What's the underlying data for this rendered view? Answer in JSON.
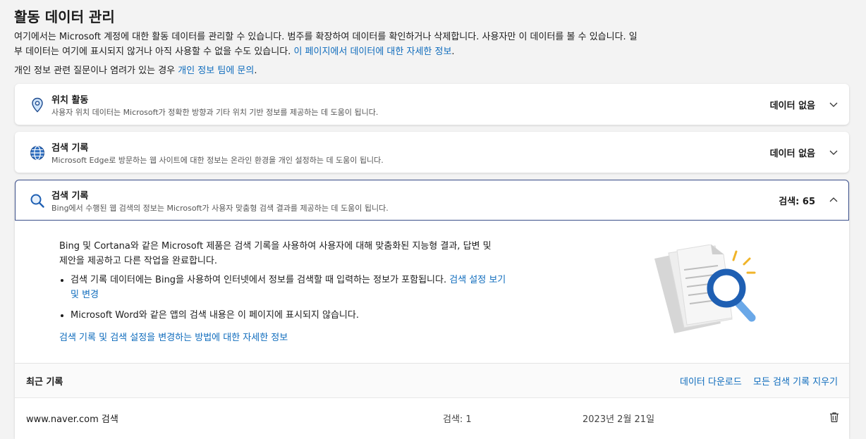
{
  "page": {
    "title": "활동 데이터 관리",
    "intro_text": "여기에서는 Microsoft 계정에 대한 활동 데이터를 관리할 수 있습니다. 범주를 확장하여 데이터를 확인하거나 삭제합니다. 사용자만 이 데이터를 볼 수 있습니다. 일부 데이터는 여기에 표시되지 않거나 아직 사용할 수 없을 수도 있습니다. ",
    "intro_link": "이 페이지에서 데이터에 대한 자세한 정보",
    "intro_end": ".",
    "privacy_text": "개인 정보 관련 질문이나 염려가 있는 경우 ",
    "privacy_link": "개인 정보 팀에 문의",
    "privacy_end": "."
  },
  "cards": [
    {
      "title": "위치 활동",
      "desc": "사용자 위치 데이터는 Microsoft가 정확한 방향과 기타 위치 기반 정보를 제공하는 데 도움이 됩니다.",
      "status": "데이터 없음",
      "icon": "location-pin-icon"
    },
    {
      "title": "검색 기록",
      "desc": "Microsoft Edge로 방문하는 웹 사이트에 대한 정보는 온라인 환경을 개인 설정하는 데 도움이 됩니다.",
      "status": "데이터 없음",
      "icon": "globe-icon"
    },
    {
      "title": "검색 기록",
      "desc": "Bing에서 수행된 웹 검색의 정보는 Microsoft가 사용자 맞춤형 검색 결과를 제공하는 데 도움이 됩니다.",
      "status": "검색: 65",
      "icon": "search-icon"
    }
  ],
  "bing": {
    "paragraph": "Bing 및 Cortana와 같은 Microsoft 제품은 검색 기록을 사용하여 사용자에 대해 맞춤화된 지능형 결과, 답변 및 제안을 제공하고 다른 작업을 완료합니다.",
    "bullet1_text": "검색 기록 데이터에는 Bing을 사용하여 인터넷에서 정보를 검색할 때 입력하는 정보가 포함됩니다. ",
    "bullet1_link": "검색 설정 보기 및 변경",
    "bullet2_text": "Microsoft Word와 같은 앱의 검색 내용은 이 페이지에 표시되지 않습니다.",
    "more_link": "검색 기록 및 검색 설정을 변경하는 방법에 대한 자세한 정보"
  },
  "recent": {
    "title": "최근 기록",
    "download": "데이터 다운로드",
    "clear_all": "모든 검색 기록 지우기",
    "rows": [
      {
        "query": "www.naver.com 검색",
        "count": "검색: 1",
        "date": "2023년 2월 21일"
      }
    ]
  },
  "colors": {
    "accent": "#0f6cbd",
    "background": "#f3f3f3",
    "expanded_border": "#3b4f8a"
  }
}
